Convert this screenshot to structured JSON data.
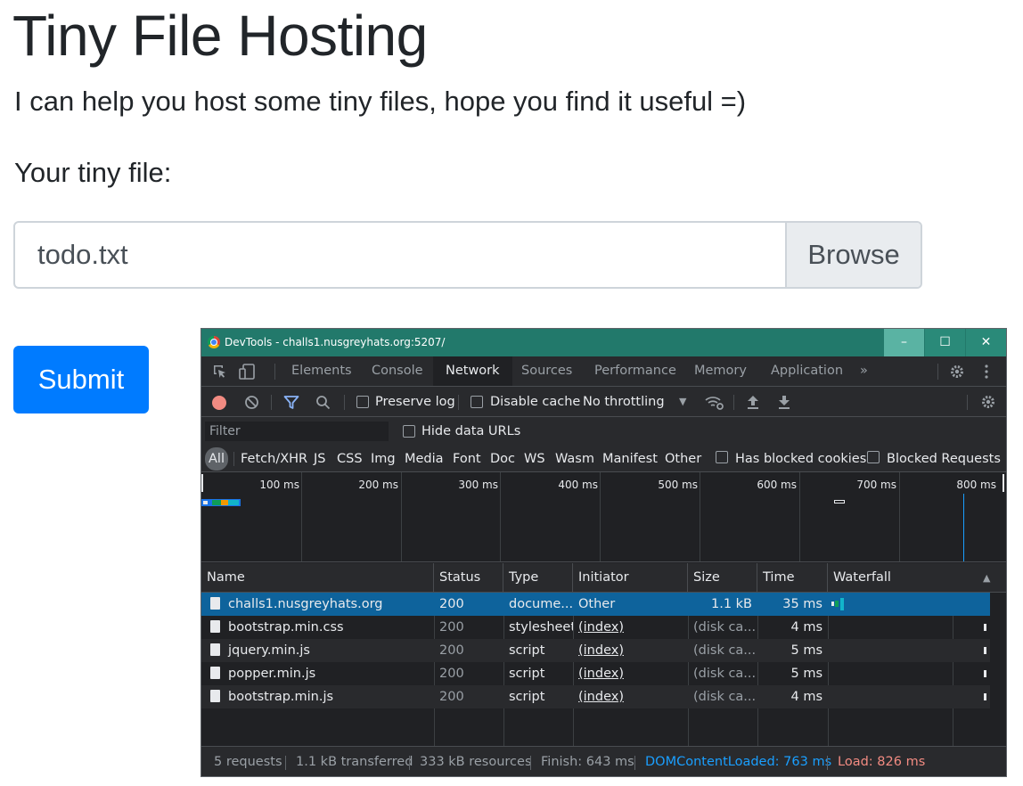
{
  "page": {
    "title": "Tiny File Hosting",
    "lead": "I can help you host some tiny files, hope you find it useful =)",
    "file_label": "Your tiny file:",
    "file_value": "todo.txt",
    "browse_label": "Browse",
    "submit_label": "Submit"
  },
  "devtools": {
    "window_title": "DevTools - challs1.nusgreyhats.org:5207/",
    "window_buttons": {
      "minimize": "–",
      "maximize": "☐",
      "close": "✕"
    },
    "tabs": [
      "Elements",
      "Console",
      "Network",
      "Sources",
      "Performance",
      "Memory",
      "Application"
    ],
    "active_tab": "Network",
    "more_tabs": "»",
    "toolbar": {
      "preserve_log": "Preserve log",
      "disable_cache": "Disable cache",
      "throttling": "No throttling"
    },
    "filter": {
      "placeholder": "Filter",
      "hide_data_urls": "Hide data URLs",
      "types": [
        "All",
        "Fetch/XHR",
        "JS",
        "CSS",
        "Img",
        "Media",
        "Font",
        "Doc",
        "WS",
        "Wasm",
        "Manifest",
        "Other"
      ],
      "has_blocked_cookies": "Has blocked cookies",
      "blocked_requests": "Blocked Requests"
    },
    "overview_ticks": [
      "100 ms",
      "200 ms",
      "300 ms",
      "400 ms",
      "500 ms",
      "600 ms",
      "700 ms",
      "800 ms"
    ],
    "columns": [
      "Name",
      "Status",
      "Type",
      "Initiator",
      "Size",
      "Time",
      "Waterfall"
    ],
    "requests": [
      {
        "name": "challs1.nusgreyhats.org",
        "status": "200",
        "type": "docume...",
        "initiator": "Other",
        "size": "1.1 kB",
        "time": "35 ms"
      },
      {
        "name": "bootstrap.min.css",
        "status": "200",
        "type": "stylesheet",
        "initiator": "(index)",
        "size": "(disk ca...",
        "time": "4 ms"
      },
      {
        "name": "jquery.min.js",
        "status": "200",
        "type": "script",
        "initiator": "(index)",
        "size": "(disk ca...",
        "time": "5 ms"
      },
      {
        "name": "popper.min.js",
        "status": "200",
        "type": "script",
        "initiator": "(index)",
        "size": "(disk ca...",
        "time": "5 ms"
      },
      {
        "name": "bootstrap.min.js",
        "status": "200",
        "type": "script",
        "initiator": "(index)",
        "size": "(disk ca...",
        "time": "4 ms"
      }
    ],
    "status": {
      "requests": "5 requests",
      "transferred": "1.1 kB transferred",
      "resources": "333 kB resources",
      "finish": "Finish: 643 ms",
      "dom_content_loaded": "DOMContentLoaded: 763 ms",
      "load": "Load: 826 ms"
    },
    "colors": {
      "titlebar": "#22796b",
      "selected_row": "#0e639c",
      "dcl": "#1a9fff",
      "load": "#f28b82"
    }
  }
}
